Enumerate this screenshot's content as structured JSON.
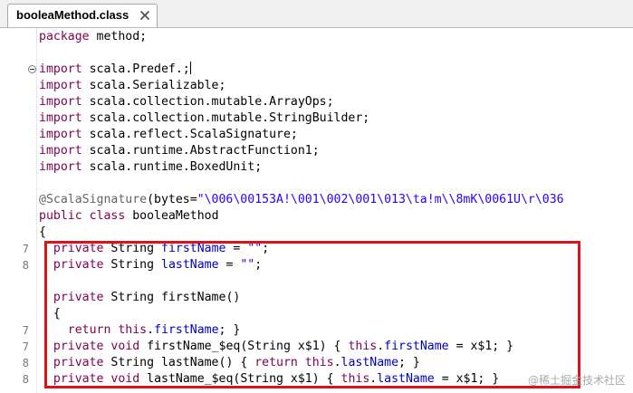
{
  "tab": {
    "title": "booleaMethod.class"
  },
  "gutter": {
    "fold_icon": "collapse-minus-icon",
    "line_numbers": [
      {
        "label": "7",
        "line": 13
      },
      {
        "label": "8",
        "line": 14
      },
      {
        "label": "7",
        "line": 18
      },
      {
        "label": "7",
        "line": 19
      },
      {
        "label": "8",
        "line": 20
      },
      {
        "label": "8",
        "line": 21
      }
    ]
  },
  "code": {
    "lines": [
      [
        {
          "t": "package",
          "c": "kw"
        },
        {
          "t": " method;"
        }
      ],
      [],
      [
        {
          "t": "import",
          "c": "kw"
        },
        {
          "t": " scala.Predef.;"
        },
        {
          "caret": true
        }
      ],
      [
        {
          "t": "import",
          "c": "kw"
        },
        {
          "t": " scala.Serializable;"
        }
      ],
      [
        {
          "t": "import",
          "c": "kw"
        },
        {
          "t": " scala.collection.mutable.ArrayOps;"
        }
      ],
      [
        {
          "t": "import",
          "c": "kw"
        },
        {
          "t": " scala.collection.mutable.StringBuilder;"
        }
      ],
      [
        {
          "t": "import",
          "c": "kw"
        },
        {
          "t": " scala.reflect.ScalaSignature;"
        }
      ],
      [
        {
          "t": "import",
          "c": "kw"
        },
        {
          "t": " scala.runtime.AbstractFunction1;"
        }
      ],
      [
        {
          "t": "import",
          "c": "kw"
        },
        {
          "t": " scala.runtime.BoxedUnit;"
        }
      ],
      [],
      [
        {
          "t": "@ScalaSignature",
          "c": "ann"
        },
        {
          "t": "(bytes="
        },
        {
          "t": "\"\\006\\00153A!\\001\\002\\001\\013\\ta!m\\\\8mK\\0061U\\r\\036",
          "c": "str"
        }
      ],
      [
        {
          "t": "public",
          "c": "kw"
        },
        {
          "t": " "
        },
        {
          "t": "class",
          "c": "kw"
        },
        {
          "t": " booleaMethod"
        }
      ],
      [
        {
          "t": "{"
        }
      ],
      [
        {
          "t": "  "
        },
        {
          "t": "private",
          "c": "kw"
        },
        {
          "t": " String "
        },
        {
          "t": "firstName",
          "c": "fld"
        },
        {
          "t": " = "
        },
        {
          "t": "\"\"",
          "c": "str"
        },
        {
          "t": ";"
        }
      ],
      [
        {
          "t": "  "
        },
        {
          "t": "private",
          "c": "kw"
        },
        {
          "t": " String "
        },
        {
          "t": "lastName",
          "c": "fld"
        },
        {
          "t": " = "
        },
        {
          "t": "\"\"",
          "c": "str"
        },
        {
          "t": ";"
        }
      ],
      [],
      [
        {
          "t": "  "
        },
        {
          "t": "private",
          "c": "kw"
        },
        {
          "t": " String firstName()"
        }
      ],
      [
        {
          "t": "  {"
        }
      ],
      [
        {
          "t": "    "
        },
        {
          "t": "return",
          "c": "kw"
        },
        {
          "t": " "
        },
        {
          "t": "this",
          "c": "kw"
        },
        {
          "t": "."
        },
        {
          "t": "firstName",
          "c": "fld"
        },
        {
          "t": "; }"
        }
      ],
      [
        {
          "t": "  "
        },
        {
          "t": "private",
          "c": "kw"
        },
        {
          "t": " "
        },
        {
          "t": "void",
          "c": "kw"
        },
        {
          "t": " firstName_$eq(String x$1) { "
        },
        {
          "t": "this",
          "c": "kw"
        },
        {
          "t": "."
        },
        {
          "t": "firstName",
          "c": "fld"
        },
        {
          "t": " = x$1; }"
        }
      ],
      [
        {
          "t": "  "
        },
        {
          "t": "private",
          "c": "kw"
        },
        {
          "t": " String lastName() { "
        },
        {
          "t": "return",
          "c": "kw"
        },
        {
          "t": " "
        },
        {
          "t": "this",
          "c": "kw"
        },
        {
          "t": "."
        },
        {
          "t": "lastName",
          "c": "fld"
        },
        {
          "t": "; }"
        }
      ],
      [
        {
          "t": "  "
        },
        {
          "t": "private",
          "c": "kw"
        },
        {
          "t": " "
        },
        {
          "t": "void",
          "c": "kw"
        },
        {
          "t": " lastName_$eq(String x$1) { "
        },
        {
          "t": "this",
          "c": "kw"
        },
        {
          "t": "."
        },
        {
          "t": "lastName",
          "c": "fld"
        },
        {
          "t": " = x$1; }"
        }
      ]
    ]
  },
  "colors": {
    "keyword": "#7f0055",
    "field": "#0000c0",
    "string": "#2a00ff",
    "annotation": "#646464",
    "highlight_border": "#d9151b"
  },
  "watermark": "@稀土掘金技术社区"
}
